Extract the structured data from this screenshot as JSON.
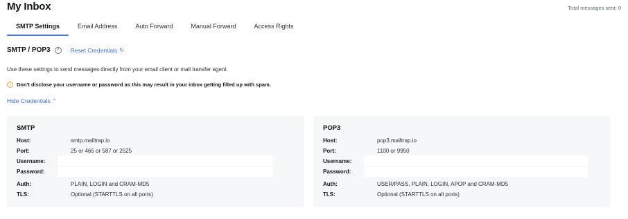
{
  "header": {
    "title": "My Inbox",
    "total_sent": "Total messages sent: 0"
  },
  "tabs": [
    {
      "label": "SMTP Settings",
      "active": true
    },
    {
      "label": "Email Address",
      "active": false
    },
    {
      "label": "Auto Forward",
      "active": false
    },
    {
      "label": "Manual Forward",
      "active": false
    },
    {
      "label": "Access Rights",
      "active": false
    }
  ],
  "section": {
    "title": "SMTP / POP3",
    "help_icon": "?",
    "reset_label": "Reset Credentials",
    "reset_icon": "↻",
    "description": "Use these settings to send messages directly from your email client or mail transfer agent.",
    "warning_icon": "!",
    "warning": "Don't disclose your username or password as this may result in your inbox getting filled up with spam.",
    "hide_label": "Hide Credentials",
    "hide_icon": "^"
  },
  "smtp": {
    "title": "SMTP",
    "host_label": "Host:",
    "host": "smtp.mailtrap.io",
    "port_label": "Port:",
    "port": "25 or 465 or 587 or 2525",
    "username_label": "Username:",
    "username": "",
    "password_label": "Password:",
    "password": "",
    "auth_label": "Auth:",
    "auth": "PLAIN, LOGIN and CRAM-MD5",
    "tls_label": "TLS:",
    "tls": "Optional (STARTTLS on all ports)"
  },
  "pop3": {
    "title": "POP3",
    "host_label": "Host:",
    "host": "pop3.mailtrap.io",
    "port_label": "Port:",
    "port": "1100 or 9950",
    "username_label": "Username:",
    "username": "",
    "password_label": "Password:",
    "password": "",
    "auth_label": "Auth:",
    "auth": "USER/PASS, PLAIN, LOGIN, APOP and CRAM-MD5",
    "tls_label": "TLS:",
    "tls": "Optional (STARTTLS on all ports)"
  },
  "colors": {
    "accent": "#3b6fd9",
    "tab_underline": "#4776e6",
    "warning": "#e0a24a",
    "panel_bg": "#f6f7f8"
  }
}
